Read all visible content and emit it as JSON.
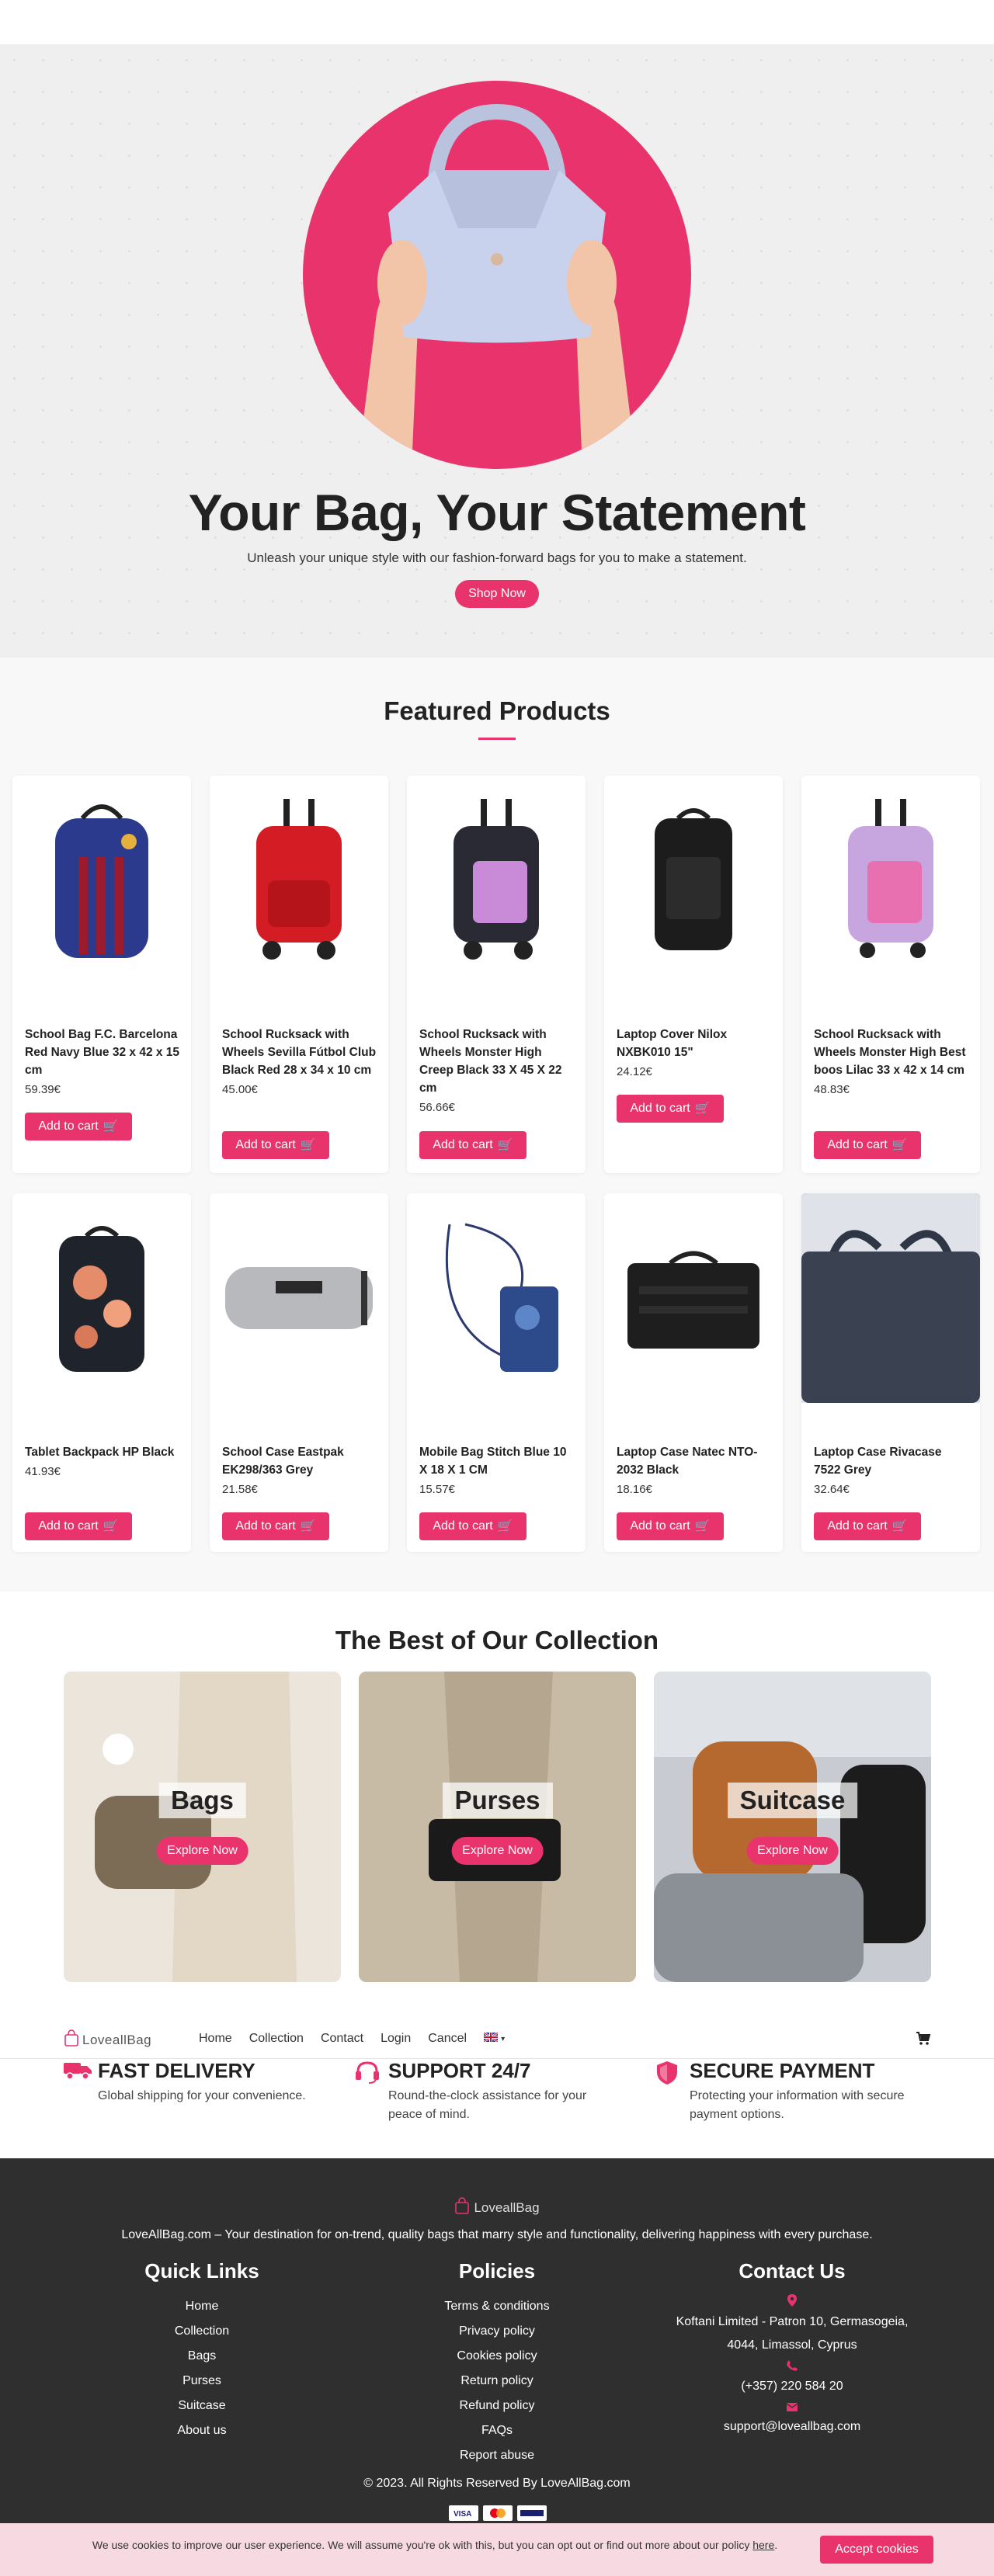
{
  "colors": {
    "accent": "#e8336d",
    "footer_bg": "#2f2f2f",
    "cookie_bg": "#f7d9e1"
  },
  "hero": {
    "title": "Your Bag, Your Statement",
    "subtitle": "Unleash your unique style with our fashion-forward bags for you to make a statement.",
    "button": "Shop Now"
  },
  "featured": {
    "title": "Featured Products",
    "cart_label": "Add to cart",
    "products": [
      {
        "name": "School Bag F.C. Barcelona Red Navy Blue 32 x 42 x 15 cm",
        "price": "59.39€"
      },
      {
        "name": "School Rucksack with Wheels Sevilla Fútbol Club Black Red 28 x 34 x 10 cm",
        "price": "45.00€"
      },
      {
        "name": "School Rucksack with Wheels Monster High Creep Black 33 X 45 X 22 cm",
        "price": "56.66€"
      },
      {
        "name": "Laptop Cover Nilox NXBK010 15\"",
        "price": "24.12€"
      },
      {
        "name": "School Rucksack with Wheels Monster High Best boos Lilac 33 x 42 x 14 cm",
        "price": "48.83€"
      },
      {
        "name": "Tablet Backpack HP Black",
        "price": "41.93€"
      },
      {
        "name": "School Case Eastpak EK298/363 Grey",
        "price": "21.58€"
      },
      {
        "name": "Mobile Bag Stitch Blue 10 X 18 X 1 CM",
        "price": "15.57€"
      },
      {
        "name": "Laptop Case Natec NTO-2032 Black",
        "price": "18.16€"
      },
      {
        "name": "Laptop Case Rivacase 7522 Grey",
        "price": "32.64€"
      }
    ]
  },
  "collection": {
    "title": "The Best of Our Collection",
    "button": "Explore Now",
    "items": [
      {
        "label": "Bags"
      },
      {
        "label": "Purses"
      },
      {
        "label": "Suitcase"
      }
    ]
  },
  "navbar": {
    "brand": "LoveallBag",
    "links": [
      "Home",
      "Collection",
      "Contact",
      "Login",
      "Cancel"
    ],
    "language_icon": "uk-flag-icon",
    "cart_icon": "cart-icon"
  },
  "features": [
    {
      "icon": "truck-icon",
      "title": "FAST DELIVERY",
      "desc": "Global shipping for your convenience."
    },
    {
      "icon": "headset-icon",
      "title": "SUPPORT 24/7",
      "desc": "Round-the-clock assistance for your peace of mind."
    },
    {
      "icon": "shield-icon",
      "title": "SECURE PAYMENT",
      "desc": "Protecting your information with secure payment options."
    }
  ],
  "footer": {
    "brand": "LoveallBag",
    "description": "LoveAllBag.com – Your destination for on-trend, quality bags that marry style and functionality, delivering happiness with every purchase.",
    "quick_links_title": "Quick Links",
    "quick_links": [
      "Home",
      "Collection",
      "Bags",
      "Purses",
      "Suitcase",
      "About us"
    ],
    "policies_title": "Policies",
    "policies": [
      "Terms & conditions",
      "Privacy policy",
      "Cookies policy",
      "Return policy",
      "Refund policy",
      "FAQs",
      "Report abuse"
    ],
    "contact_title": "Contact Us",
    "address_line1": "Koftani Limited -  Patron 10, Germasogeia,",
    "address_line2": "4044,  Limassol,  Cyprus",
    "phone": "(+357) 220 584 20",
    "email": "support@loveallbag.com",
    "copyright": "© 2023. All Rights Reserved By LoveAllBag.com"
  },
  "cookie": {
    "text": "We use cookies to improve our user experience. We will assume you're ok with this, but you can opt out or find out more about our policy",
    "link": "here",
    "button": "Accept cookies"
  }
}
